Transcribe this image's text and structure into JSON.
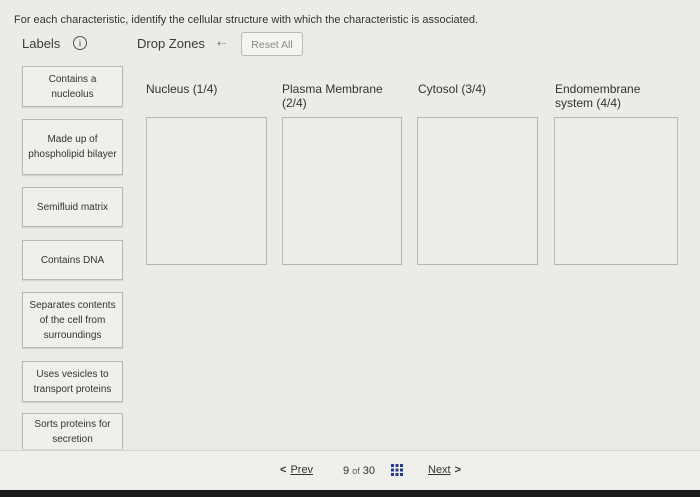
{
  "instruction": "For each characteristic, identify the cellular structure with which the characteristic is associated.",
  "header": {
    "labels_title": "Labels",
    "info_icon_glyph": "i",
    "dropzones_title": "Drop Zones",
    "undo_icon_glyph": "⇠",
    "reset_label": "Reset All"
  },
  "labels": [
    "Contains a nucleolus",
    "Made up of phospholipid bilayer",
    "Semifluid matrix",
    "Contains DNA",
    "Separates contents of the cell from surroundings",
    "Uses vesicles to transport proteins",
    "Sorts proteins for secretion"
  ],
  "zones": [
    {
      "title": "Nucleus (1/4)"
    },
    {
      "title": "Plasma Membrane (2/4)"
    },
    {
      "title": "Cytosol (3/4)"
    },
    {
      "title": "Endomembrane system (4/4)"
    }
  ],
  "nav": {
    "prev_chevron": "<",
    "prev_label": "Prev",
    "page_current": "9",
    "page_of": "of",
    "page_total": "30",
    "next_label": "Next",
    "next_chevron": ">",
    "grid_icon": "grid-icon",
    "accent_color": "#1f3a8a"
  }
}
